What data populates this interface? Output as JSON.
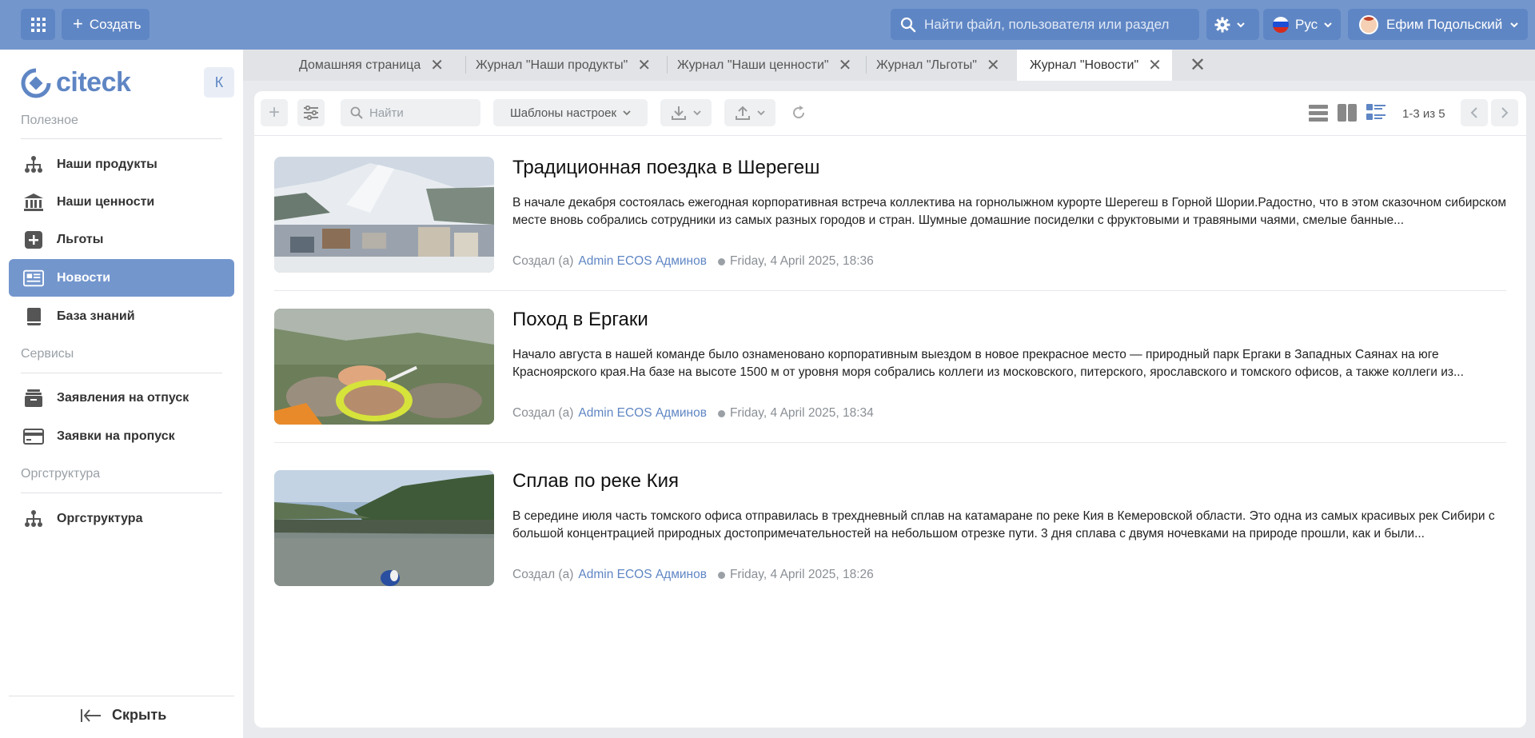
{
  "topbar": {
    "create_label": "Создать",
    "search_placeholder": "Найти файл, пользователя или раздел",
    "lang_label": "Рус",
    "user_name": "Ефим Подольский",
    "brand_color": "#7396cd"
  },
  "sidebar": {
    "logo_text": "citeck",
    "collapse_label": "К",
    "sections": {
      "useful": "Полезное",
      "services": "Сервисы",
      "org": "Оргструктура"
    },
    "items": [
      {
        "label": "Наши продукты",
        "icon": "hierarchy-icon"
      },
      {
        "label": "Наши ценности",
        "icon": "bank-icon"
      },
      {
        "label": "Льготы",
        "icon": "plus-square-icon"
      },
      {
        "label": "Новости",
        "icon": "newspaper-icon",
        "active": true
      },
      {
        "label": "База знаний",
        "icon": "book-icon"
      },
      {
        "label": "Заявления на отпуск",
        "icon": "archive-icon"
      },
      {
        "label": "Заявки на пропуск",
        "icon": "card-icon"
      },
      {
        "label": "Оргструктура",
        "icon": "hierarchy-icon"
      }
    ],
    "hide_label": "Скрыть"
  },
  "tabs": [
    {
      "label": "Домашняя страница"
    },
    {
      "label": "Журнал \"Наши продукты\""
    },
    {
      "label": "Журнал \"Наши ценности\""
    },
    {
      "label": "Журнал \"Льготы\""
    },
    {
      "label": "Журнал \"Новости\"",
      "active": true
    }
  ],
  "toolbar": {
    "search_placeholder": "Найти",
    "templates_label": "Шаблоны настроек",
    "pager_text": "1-3 из 5"
  },
  "news": [
    {
      "title": "Традиционная поездка в Шерегеш",
      "text": "В начале декабря состоялась ежегодная корпоративная встреча коллектива на горнолыжном курорте Шерегеш в Горной Шории.Радостно, что в этом сказочном сибирском месте вновь собрались сотрудники из самых разных городов и стран. Шумные домашние посиделки с фруктовыми и травяными чаями, смелые банные...",
      "created_by_label": "Создал (а)",
      "author": "Admin ECOS Админов",
      "date": "Friday, 4 April 2025, 18:36"
    },
    {
      "title": "Поход в Ергаки",
      "text": "Начало августа в нашей команде было ознаменовано корпоративным выездом в новое прекрасное место — природный парк Ергаки в Западных Саянах на юге Красноярского края.На базе на высоте 1500 м от уровня моря собрались коллеги из московского, питерского, ярославского и томского офисов, а также коллеги из...",
      "created_by_label": "Создал (а)",
      "author": "Admin ECOS Админов",
      "date": "Friday, 4 April 2025, 18:34"
    },
    {
      "title": "Сплав по реке Кия",
      "text": "В середине июля часть томского офиса отправилась в трехдневный сплав на катамаране по реке Кия в Кемеровской области. Это одна из самых красивых рек Сибири с большой концентрацией природных достопримечательностей на небольшом отрезке пути. 3 дня сплава с двумя ночевками на природе прошли, как и были...",
      "created_by_label": "Создал (а)",
      "author": "Admin ECOS Админов",
      "date": "Friday, 4 April 2025, 18:26"
    }
  ]
}
